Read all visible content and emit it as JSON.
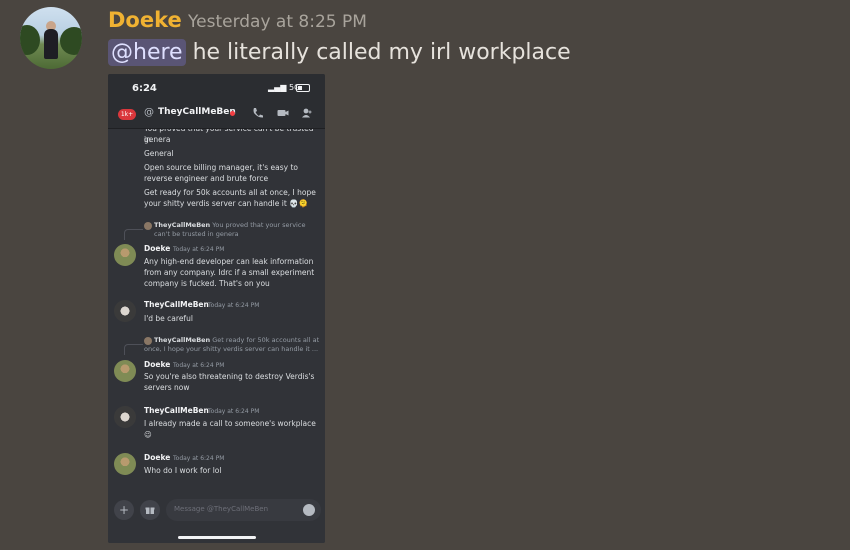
{
  "post": {
    "author": "Doeke",
    "timestamp": "Yesterday at 8:25 PM",
    "mention": "@here",
    "text": "he literally called my irl workplace",
    "author_color": "#f0b232"
  },
  "phone": {
    "status_time": "6:24",
    "signal": "5G",
    "unread_badge": "1k+",
    "channel_name": "TheyCallMeBen",
    "top_lines": [
      "You proved that your service can't be trusted in",
      "genera",
      "General",
      "Open source billing manager, it's easy to",
      "reverse engineer and brute force",
      "Get ready for 50k accounts all at once, I hope",
      "your shitty verdis server can handle it 💀🫠"
    ],
    "messages": [
      {
        "reply_author": "TheyCallMeBen",
        "reply_text": "You proved that your service can't be trusted in genera",
        "author": "Doeke",
        "time": "Today at 6:24 PM",
        "lines": [
          "Any high-end developer can leak information",
          "from any company. Idrc if a small experiment",
          "company is fucked. That's on you"
        ]
      },
      {
        "author": "TheyCallMeBen",
        "time": "Today at 6:24 PM",
        "lines": [
          "I'd be careful"
        ]
      },
      {
        "reply_author": "TheyCallMeBen",
        "reply_text": "Get ready for 50k accounts all at once, I hope your shitty verdis server can handle it ...",
        "author": "Doeke",
        "time": "Today at 6:24 PM",
        "lines": [
          "So you're also threatening to destroy Verdis's",
          "servers now"
        ]
      },
      {
        "author": "TheyCallMeBen",
        "time": "Today at 6:24 PM",
        "lines": [
          "I already made a call to someone's workplace",
          "😉"
        ]
      },
      {
        "author": "Doeke",
        "time": "Today at 6:24 PM",
        "lines": [
          "Who do I work for lol"
        ]
      }
    ],
    "composer_placeholder": "Message @TheyCallMeBen"
  }
}
